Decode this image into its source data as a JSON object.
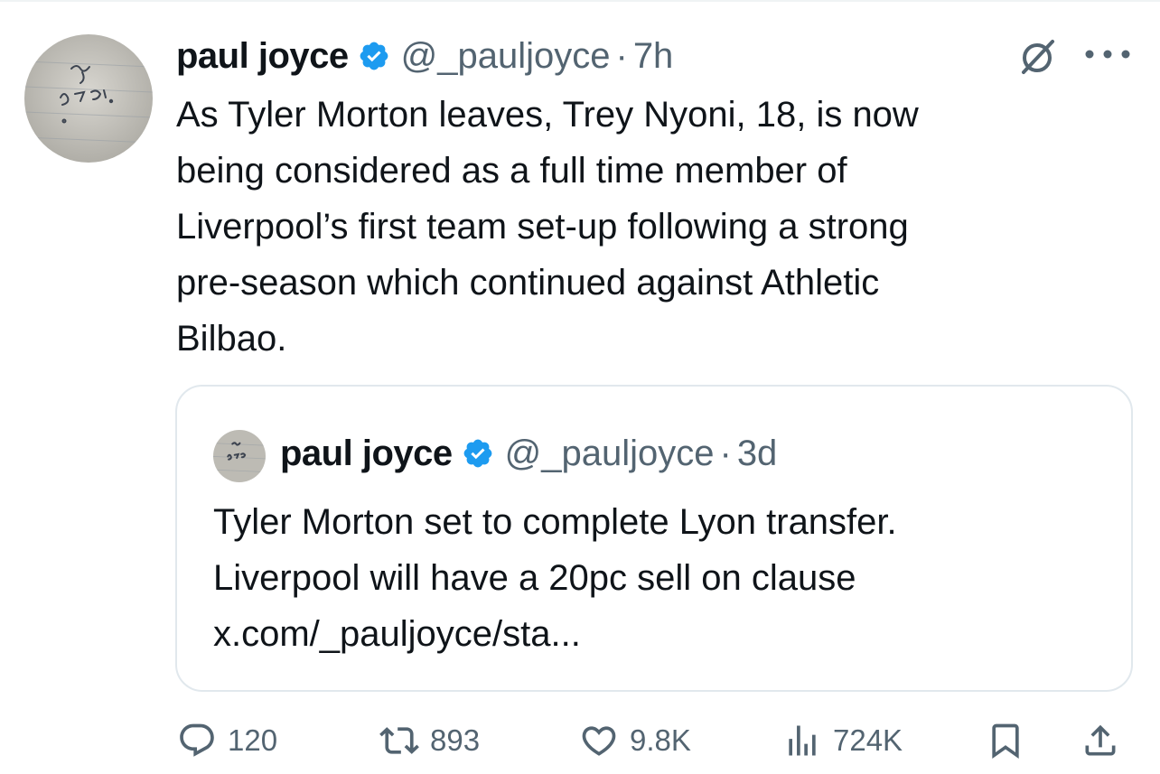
{
  "tweet": {
    "author_name": "paul joyce",
    "author_handle": "@_pauljoyce",
    "separator": "·",
    "time": "7h",
    "text": "As Tyler Morton leaves, Trey Nyoni, 18, is now\nbeing considered as a full time member of\nLiverpool’s first team set-up following a strong\npre-season which continued against Athletic\nBilbao."
  },
  "quoted_tweet": {
    "author_name": "paul joyce",
    "author_handle": "@_pauljoyce",
    "separator": "·",
    "time": "3d",
    "text": "Tyler Morton set to complete Lyon transfer.\nLiverpool will have a 20pc sell on clause\nx.com/_pauljoyce/sta..."
  },
  "actions": {
    "replies": "120",
    "reposts": "893",
    "likes": "9.8K",
    "views": "724K"
  },
  "icons": {
    "verified": "verified-badge-icon",
    "grok": "grok-icon",
    "more": "more-icon",
    "reply": "reply-icon",
    "repost": "repost-icon",
    "like": "heart-icon",
    "views": "analytics-icon",
    "bookmark": "bookmark-icon",
    "share": "share-icon"
  },
  "colors": {
    "text": "#0f1419",
    "secondary": "#536471",
    "verified": "#1d9bf0",
    "border": "#e1e8ed"
  }
}
